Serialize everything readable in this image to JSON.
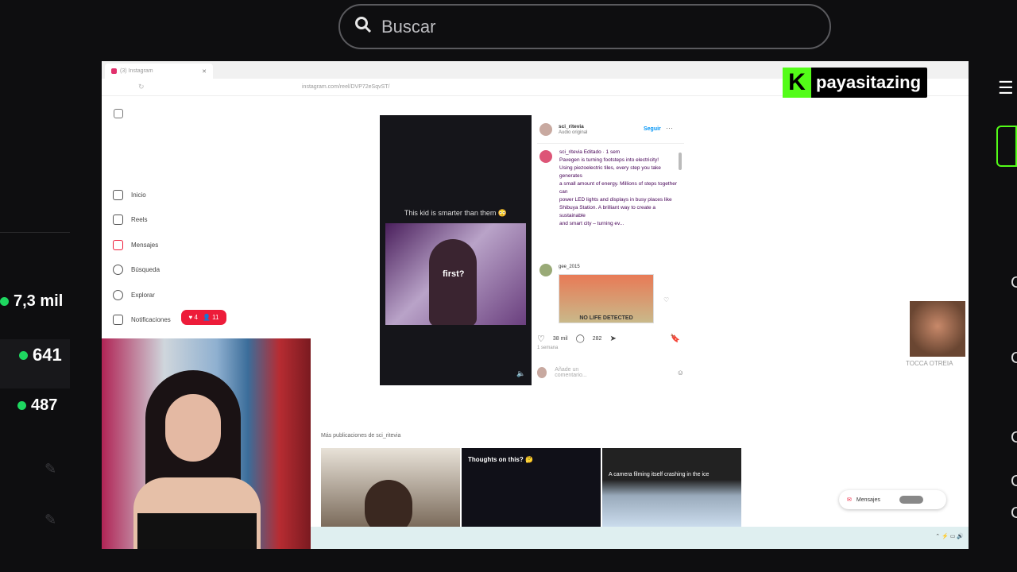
{
  "search": {
    "placeholder": "Buscar"
  },
  "stats": [
    {
      "value": "7,3 mil"
    },
    {
      "value": "641"
    },
    {
      "value": "487"
    }
  ],
  "kick": {
    "logo": "K",
    "username": "payasitazing"
  },
  "browser": {
    "tab_title": "(3) Instagram",
    "url": "instagram.com/reel/DVP72eSqvST/"
  },
  "instagram": {
    "nav": [
      "Inicio",
      "Reels",
      "Mensajes",
      "Búsqueda",
      "Explorar",
      "Notificaciones"
    ],
    "notif_badge": [
      "4",
      "11"
    ],
    "video_caption": "This kid is smarter than them 😳",
    "video_overlay": "first?",
    "author": {
      "name": "sci_ritevia",
      "audio": "Audio original",
      "follow": "Seguir"
    },
    "post_text": "sci_ritevia Editado · 1 sem\nPavegen is turning footsteps into electricity!\nUsing piezoelectric tiles, every step you take generates\na small amount of energy. Millions of steps together can\npower LED lights and displays in busy places like\nShibuya Station. A brilliant way to create a sustainable\nand smart city – turning ev...",
    "comment_user": "gee_2015",
    "comment_image_text": "NO LIFE DETECTED",
    "likes": "38 mil",
    "comments_count": "282",
    "time": "1 semana",
    "add_comment": "Añade un comentario...",
    "more_posts": "Más publicaciones de sci_ritevia",
    "thumbs": [
      "",
      "Thoughts on this? 🤔",
      "A camera filming itself crashing in the ice"
    ],
    "messages_pill": "Mensajes"
  },
  "meme_caption": "TOCCA OTREIA"
}
